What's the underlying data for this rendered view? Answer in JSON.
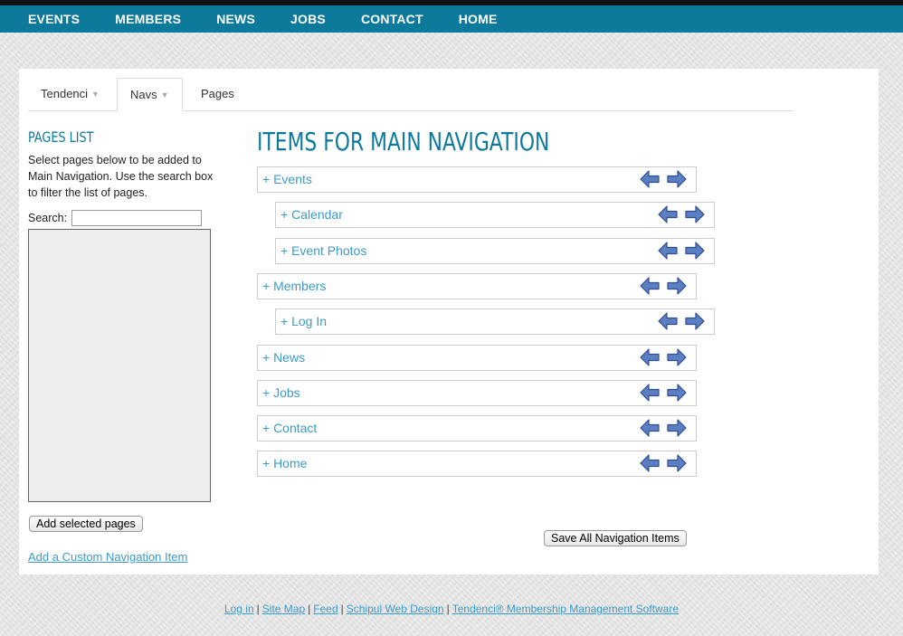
{
  "topnav": [
    "EVENTS",
    "MEMBERS",
    "NEWS",
    "JOBS",
    "CONTACT",
    "HOME"
  ],
  "tabs": [
    {
      "label": "Tendenci",
      "has_caret": true
    },
    {
      "label": "Navs",
      "has_caret": true,
      "active": true
    },
    {
      "label": "Pages",
      "has_caret": false
    }
  ],
  "pages_list": {
    "title": "PAGES LIST",
    "description": "Select pages below to be added to Main Navigation. Use the search box to filter the list of pages.",
    "search_label": "Search:",
    "search_value": "",
    "add_button": "Add selected pages",
    "custom_link": "Add a Custom Navigation Item"
  },
  "main": {
    "title": "ITEMS FOR MAIN NAVIGATION",
    "items": [
      {
        "label": "+ Events",
        "level": 0
      },
      {
        "label": "+ Calendar",
        "level": 1
      },
      {
        "label": "+ Event Photos",
        "level": 1
      },
      {
        "label": "+ Members",
        "level": 0
      },
      {
        "label": "+ Log In",
        "level": 1
      },
      {
        "label": "+ News",
        "level": 0
      },
      {
        "label": "+ Jobs",
        "level": 0
      },
      {
        "label": "+ Contact",
        "level": 0
      },
      {
        "label": "+ Home",
        "level": 0
      }
    ],
    "save_button": "Save All Navigation Items"
  },
  "footer": {
    "links": [
      "Log in",
      "Site Map",
      "Feed",
      "Schipul Web Design",
      "Tendenci® Membership Management Software"
    ],
    "separator": "|"
  },
  "colors": {
    "brand": "#0d7a9c",
    "link": "#3a9bc9",
    "arrow": "#5b7fc2"
  },
  "icons": {
    "indent_arrow": "arrow-left-icon",
    "outdent_arrow": "arrow-right-icon"
  }
}
